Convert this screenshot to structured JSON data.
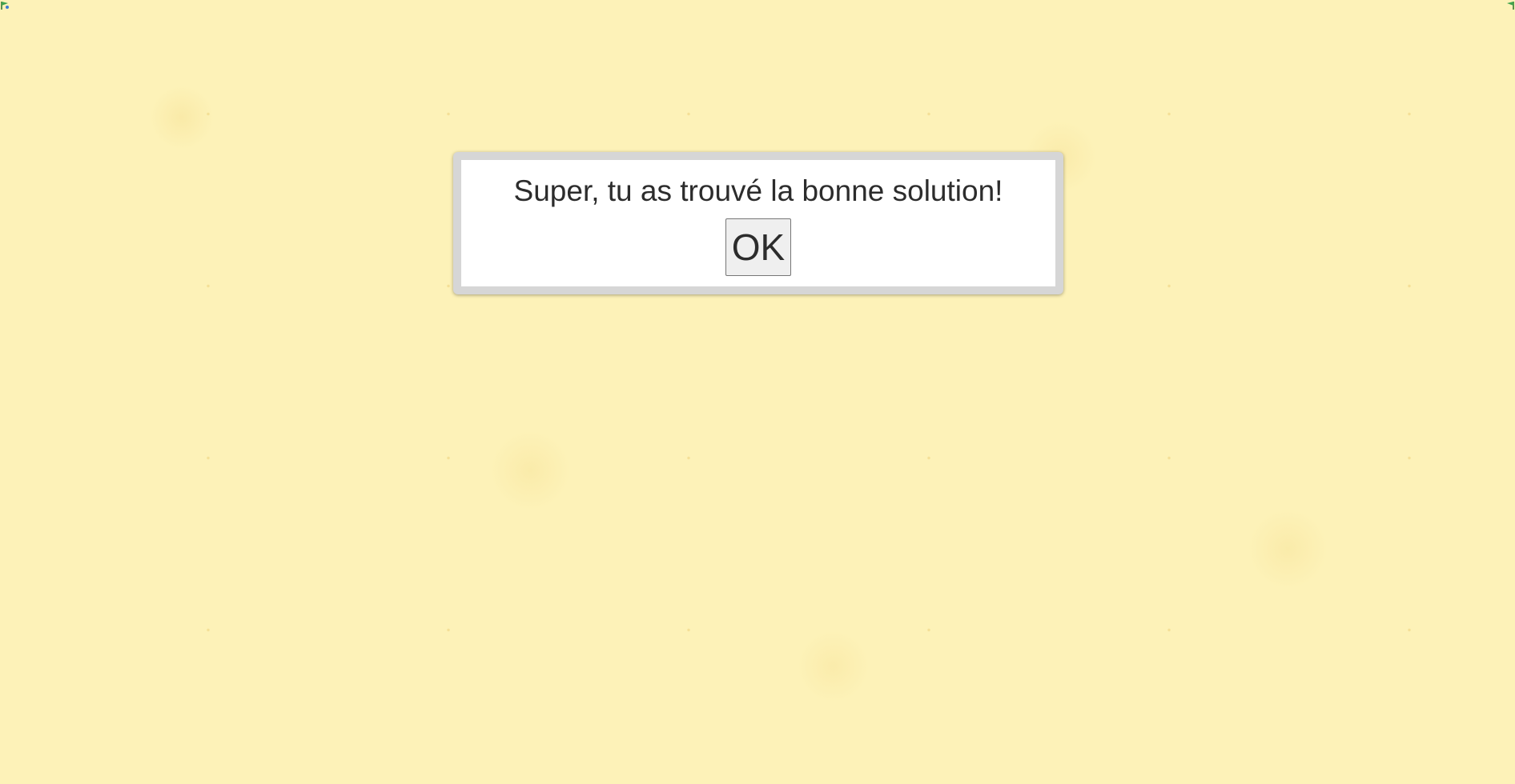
{
  "dialog": {
    "message": "Super, tu as trouvé la bonne solution!",
    "ok_label": "OK"
  },
  "colors": {
    "background": "#fdf2b8",
    "dialog_frame": "#d6d6d6",
    "dialog_body": "#ffffff",
    "text": "#2c2c2c",
    "button_bg": "#efefef"
  },
  "icons": {
    "top_left": "small-flag-icon",
    "top_right": "small-flag-icon"
  }
}
